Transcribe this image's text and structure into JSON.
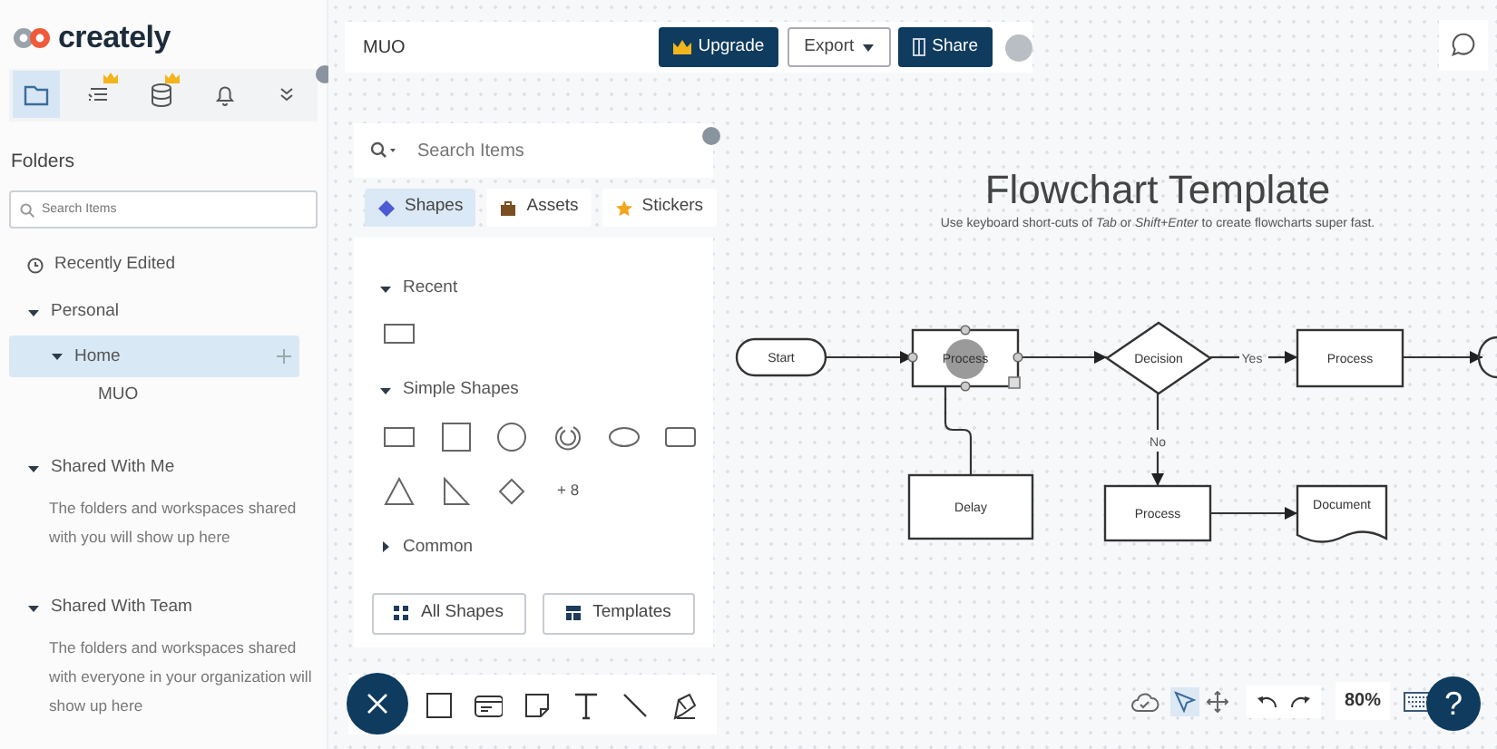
{
  "logo": {
    "text": "creately"
  },
  "sidebar": {
    "nav_tabs": [
      {
        "kind": "folders",
        "selected": true,
        "premium": false
      },
      {
        "kind": "outline",
        "selected": false,
        "premium": true
      },
      {
        "kind": "data",
        "selected": false,
        "premium": true
      },
      {
        "kind": "notifications",
        "selected": false,
        "premium": false
      },
      {
        "kind": "more",
        "selected": false,
        "premium": false
      }
    ],
    "heading": "Folders",
    "search": {
      "placeholder": "Search Items"
    },
    "recent": "Recently Edited",
    "tree": [
      {
        "label": "Personal",
        "expanded": true,
        "selected": false,
        "children": [
          {
            "label": "Home",
            "expanded": true,
            "selected": true,
            "children": [
              {
                "label": "MUO",
                "selected": false
              }
            ]
          }
        ]
      }
    ],
    "shared_sections": [
      {
        "label": "Shared With Me",
        "expanded": true,
        "note": "The folders and workspaces shared with you will show up here"
      },
      {
        "label": "Shared With Team",
        "expanded": true,
        "note": "The folders and workspaces shared with everyone in your organization will show up here"
      }
    ]
  },
  "topbar": {
    "document_title": "MUO",
    "buttons": [
      {
        "kind": "upgrade",
        "label": "Upgrade"
      },
      {
        "kind": "export",
        "label": "Export"
      },
      {
        "kind": "share",
        "label": "Share"
      }
    ]
  },
  "shapes_panel": {
    "search": {
      "placeholder": "Search Items"
    },
    "tabs": [
      {
        "kind": "shapes",
        "label": "Shapes",
        "selected": true
      },
      {
        "kind": "assets",
        "label": "Assets",
        "selected": false
      },
      {
        "kind": "stickers",
        "label": "Stickers",
        "selected": false
      }
    ],
    "sections": [
      {
        "kind": "recent",
        "title": "Recent",
        "expanded": true
      },
      {
        "kind": "simple",
        "title": "Simple Shapes",
        "expanded": true,
        "more": "+ 8"
      },
      {
        "title": "Common",
        "expanded": false
      }
    ],
    "buttons": [
      {
        "kind": "all-shapes",
        "label": "All Shapes"
      },
      {
        "kind": "templates",
        "label": "Templates"
      }
    ]
  },
  "canvas": {
    "title": "Flowchart Template",
    "subtitle": "Use keyboard short-cuts of *Tab* or *Shift+Enter* to create flowcharts super fast.",
    "nodes": [
      {
        "kind": "terminator",
        "text": "Start",
        "selected": false
      },
      {
        "kind": "process",
        "text": "Process",
        "selected": true
      },
      {
        "kind": "decision",
        "text": "Decision",
        "selected": false
      },
      {
        "kind": "process",
        "text": "Process",
        "selected": false
      },
      {
        "kind": "process",
        "text": "Delay",
        "selected": false
      },
      {
        "kind": "process",
        "text": "Process",
        "selected": false
      },
      {
        "kind": "document",
        "text": "Document",
        "selected": false
      }
    ],
    "edge_labels": [
      "Yes",
      "No"
    ]
  },
  "view_controls": {
    "pointer_selected": true,
    "zoom": "80%",
    "help": "?"
  }
}
